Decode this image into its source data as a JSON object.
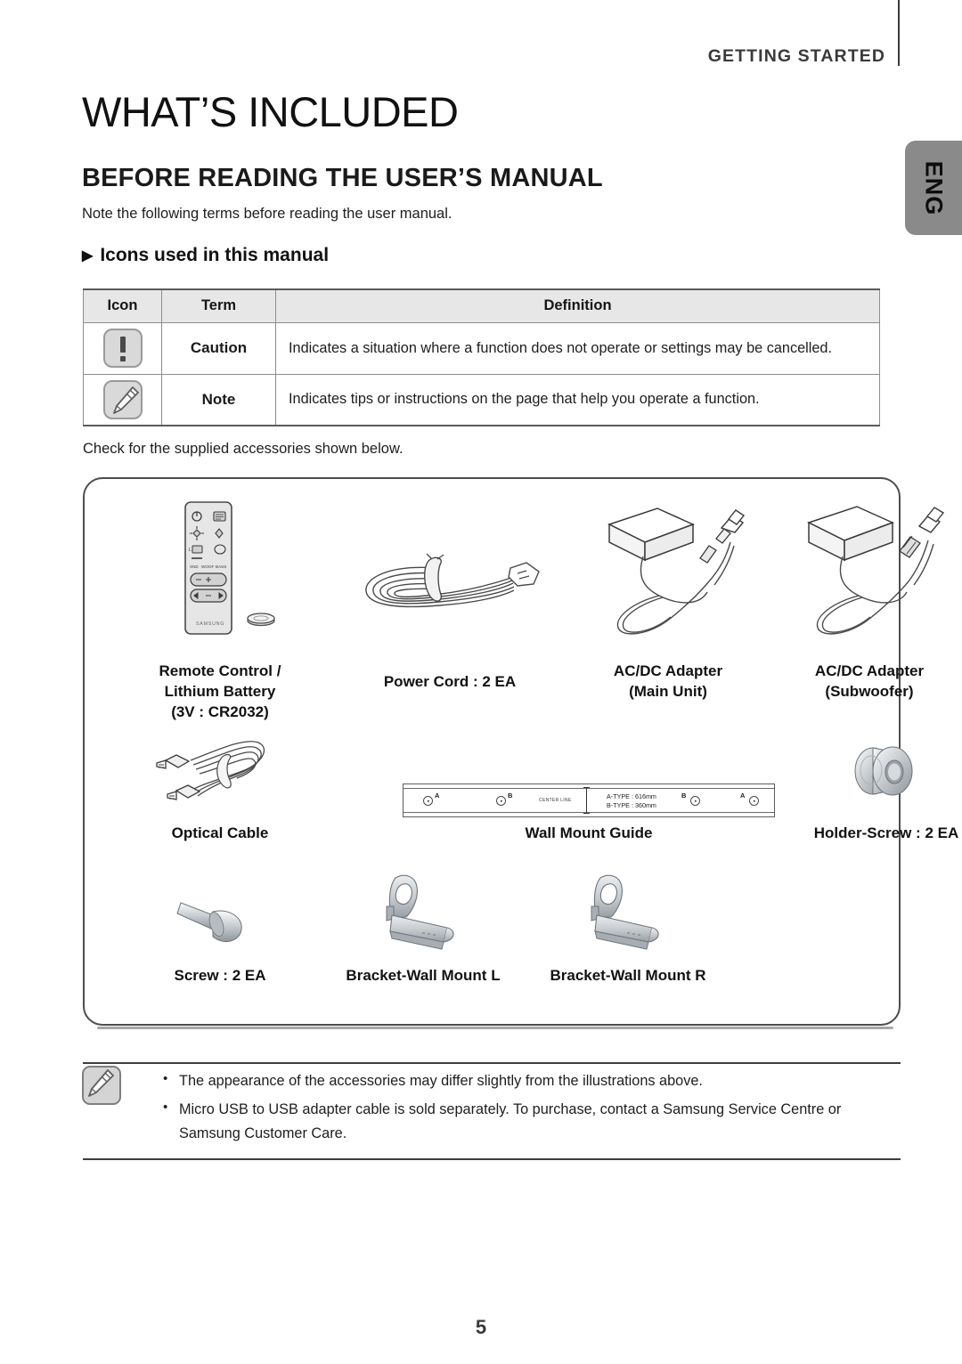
{
  "header": {
    "kicker": "GETTING STARTED",
    "language_tab": "ENG"
  },
  "titles": {
    "main": "WHAT’S INCLUDED",
    "sub": "BEFORE READING THE USER’S MANUAL",
    "lede": "Note the following terms before reading the user manual.",
    "section_arrow": "▶",
    "section": "Icons used in this manual"
  },
  "icon_table": {
    "headers": [
      "Icon",
      "Term",
      "Definition"
    ],
    "rows": [
      {
        "icon": "caution-icon",
        "term": "Caution",
        "definition": "Indicates a situation where a function does not operate or settings may be cancelled."
      },
      {
        "icon": "note-icon",
        "term": "Note",
        "definition": "Indicates tips or instructions on the page that help you operate a function."
      }
    ]
  },
  "check_line": "Check for the supplied accessories shown below.",
  "accessories": [
    {
      "id": "remote-control",
      "label": "Remote Control /\nLithium Battery\n(3V : CR2032)"
    },
    {
      "id": "power-cord",
      "label": "Power Cord : 2 EA"
    },
    {
      "id": "ac-dc-adapter-main",
      "label": "AC/DC Adapter\n(Main Unit)"
    },
    {
      "id": "ac-dc-adapter-sub",
      "label": "AC/DC Adapter\n(Subwoofer)"
    },
    {
      "id": "optical-cable",
      "label": "Optical Cable"
    },
    {
      "id": "wall-mount-guide",
      "label": "Wall Mount Guide"
    },
    {
      "id": "holder-screw",
      "label": "Holder-Screw : 2 EA"
    },
    {
      "id": "screw",
      "label": "Screw : 2 EA"
    },
    {
      "id": "bracket-wall-mount-l",
      "label": "Bracket-Wall Mount L"
    },
    {
      "id": "bracket-wall-mount-r",
      "label": "Bracket-Wall Mount R"
    }
  ],
  "wall_mount_guide_detail": {
    "hole_labels": [
      "A",
      "B",
      "B",
      "A"
    ],
    "center_line_label": "CENTER LINE",
    "type_a": "A-TYPE : 616mm",
    "type_b": "B-TYPE : 360mm"
  },
  "notes": {
    "icon": "note-icon",
    "items": [
      "The appearance of the accessories may differ slightly from the illustrations above.",
      "Micro USB to USB adapter cable is sold separately. To purchase, contact a Samsung Service Centre or Samsung Customer Care."
    ]
  },
  "page_number": "5",
  "brand": "SAMSUNG",
  "colors": {
    "tab_gray": "#8a8a8a",
    "table_header": "#e7e7e7",
    "rule": "#3d3d3d"
  }
}
